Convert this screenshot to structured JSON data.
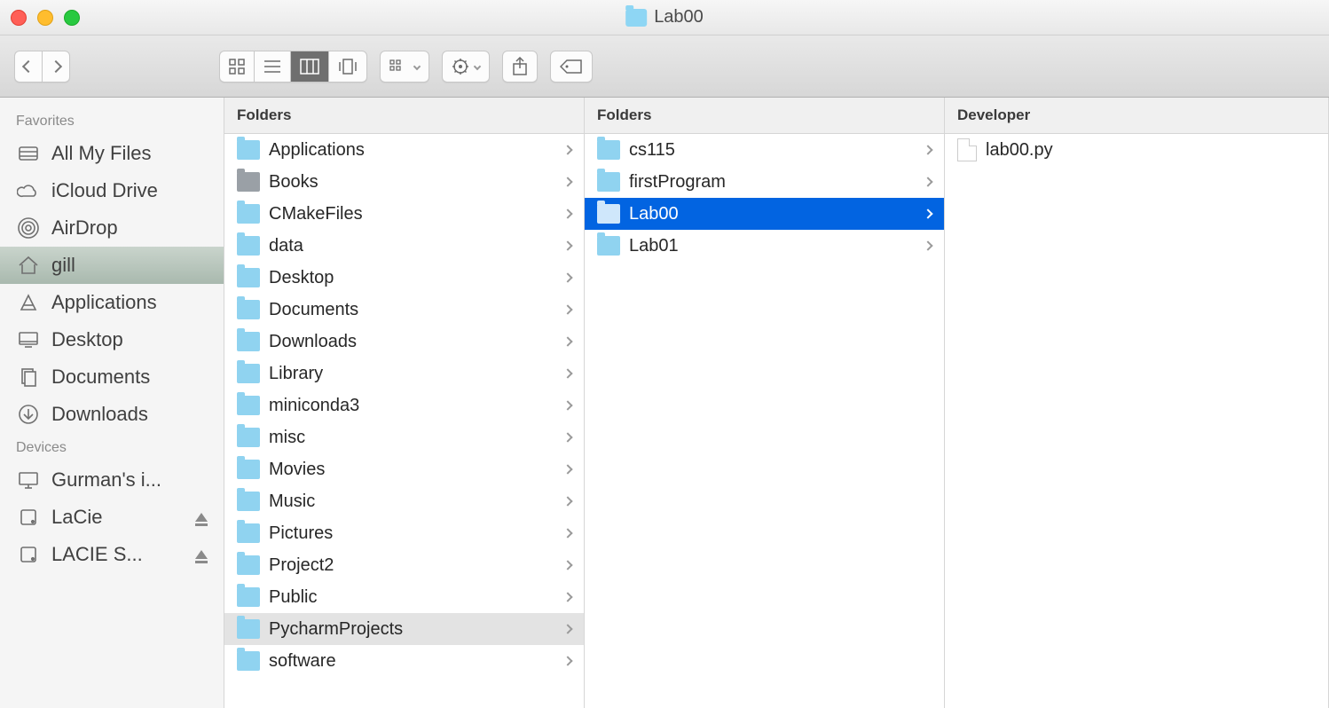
{
  "window": {
    "title": "Lab00"
  },
  "sidebar": {
    "sections": [
      {
        "heading": "Favorites",
        "items": [
          {
            "label": "All My Files",
            "icon": "all-my-files",
            "selected": false
          },
          {
            "label": "iCloud Drive",
            "icon": "cloud",
            "selected": false
          },
          {
            "label": "AirDrop",
            "icon": "airdrop",
            "selected": false
          },
          {
            "label": "gill",
            "icon": "home",
            "selected": true
          },
          {
            "label": "Applications",
            "icon": "applications",
            "selected": false
          },
          {
            "label": "Desktop",
            "icon": "desktop",
            "selected": false
          },
          {
            "label": "Documents",
            "icon": "documents",
            "selected": false
          },
          {
            "label": "Downloads",
            "icon": "downloads",
            "selected": false
          }
        ]
      },
      {
        "heading": "Devices",
        "items": [
          {
            "label": "Gurman's i...",
            "icon": "computer",
            "selected": false,
            "eject": false
          },
          {
            "label": "LaCie",
            "icon": "disk",
            "selected": false,
            "eject": true
          },
          {
            "label": "LACIE S...",
            "icon": "disk",
            "selected": false,
            "eject": true
          }
        ]
      }
    ]
  },
  "columns": [
    {
      "header": "Folders",
      "items": [
        {
          "label": "Applications",
          "type": "folder",
          "hasChildren": true
        },
        {
          "label": "Books",
          "type": "folder-books",
          "hasChildren": true
        },
        {
          "label": "CMakeFiles",
          "type": "folder",
          "hasChildren": true
        },
        {
          "label": "data",
          "type": "folder",
          "hasChildren": true
        },
        {
          "label": "Desktop",
          "type": "folder",
          "hasChildren": true
        },
        {
          "label": "Documents",
          "type": "folder",
          "hasChildren": true
        },
        {
          "label": "Downloads",
          "type": "folder",
          "hasChildren": true
        },
        {
          "label": "Library",
          "type": "folder",
          "hasChildren": true
        },
        {
          "label": "miniconda3",
          "type": "folder",
          "hasChildren": true
        },
        {
          "label": "misc",
          "type": "folder",
          "hasChildren": true
        },
        {
          "label": "Movies",
          "type": "folder",
          "hasChildren": true
        },
        {
          "label": "Music",
          "type": "folder",
          "hasChildren": true
        },
        {
          "label": "Pictures",
          "type": "folder",
          "hasChildren": true
        },
        {
          "label": "Project2",
          "type": "folder",
          "hasChildren": true
        },
        {
          "label": "Public",
          "type": "folder",
          "hasChildren": true
        },
        {
          "label": "PycharmProjects",
          "type": "folder",
          "hasChildren": true,
          "selectedPath": true
        },
        {
          "label": "software",
          "type": "folder",
          "hasChildren": true
        }
      ]
    },
    {
      "header": "Folders",
      "items": [
        {
          "label": "cs115",
          "type": "folder",
          "hasChildren": true
        },
        {
          "label": "firstProgram",
          "type": "folder",
          "hasChildren": true
        },
        {
          "label": "Lab00",
          "type": "folder",
          "hasChildren": true,
          "selected": true
        },
        {
          "label": "Lab01",
          "type": "folder",
          "hasChildren": true
        }
      ]
    },
    {
      "header": "Developer",
      "items": [
        {
          "label": "lab00.py",
          "type": "file",
          "hasChildren": false
        }
      ]
    }
  ]
}
